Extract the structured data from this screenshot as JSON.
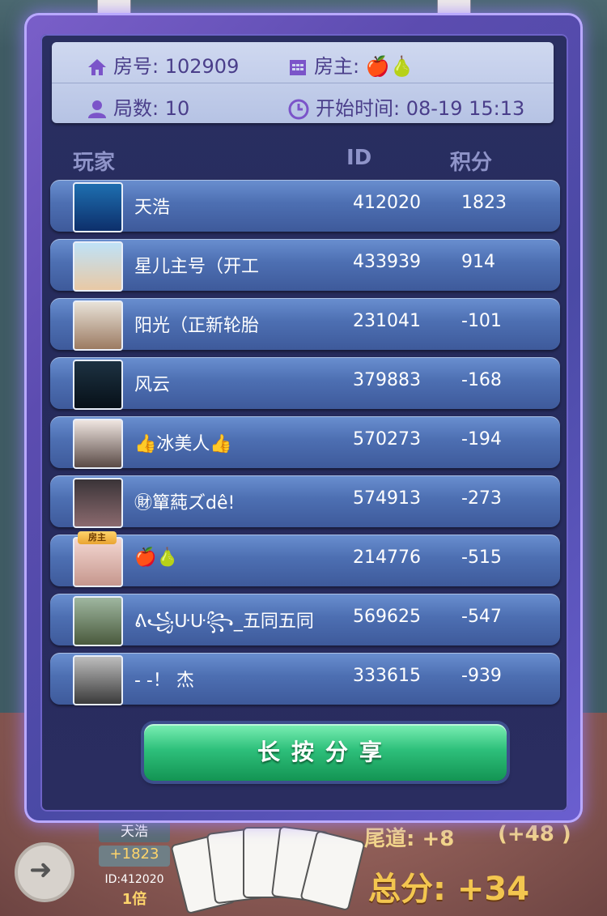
{
  "room": {
    "room_label": "房号",
    "room_value": "102909",
    "host_label": "房主",
    "host_value": "🍎🍐",
    "rounds_label": "局数",
    "rounds_value": "10",
    "start_label": "开始时间",
    "start_value": "08-19 15:13"
  },
  "columns": {
    "player": "玩家",
    "id": "ID",
    "score": "积分"
  },
  "players": [
    {
      "name": "天浩",
      "id": "412020",
      "score": "1823"
    },
    {
      "name": "星儿主号（开工",
      "id": "433939",
      "score": "914"
    },
    {
      "name": "阳光（正新轮胎",
      "id": "231041",
      "score": "-101"
    },
    {
      "name": "风云",
      "id": "379883",
      "score": "-168"
    },
    {
      "name": "👍冰美人👍",
      "id": "570273",
      "score": "-194"
    },
    {
      "name": "㊖簞蒓ズdê!",
      "id": "574913",
      "score": "-273"
    },
    {
      "name": "🍎🍐",
      "id": "214776",
      "score": "-515",
      "badge": "房主"
    },
    {
      "name": "ᕕ꧁ᑘᑘ꧂_五同五同",
      "id": "569625",
      "score": "-547"
    },
    {
      "name": "- -！ 杰",
      "id": "333615",
      "score": "-939"
    }
  ],
  "share_button": "长按分享",
  "background": {
    "player_name": "天浩",
    "player_score": "+1823",
    "player_id": "ID:412020",
    "multiplier": "1倍",
    "tail_label": "尾道: +8",
    "tail_extra": "(+48 )",
    "total": "总分: +34"
  },
  "colors": {
    "dialog_border": "#7a5fc9",
    "row_bg": "#4d6fb2",
    "button": "#2ec07b",
    "info_text": "#4a3e8a"
  }
}
